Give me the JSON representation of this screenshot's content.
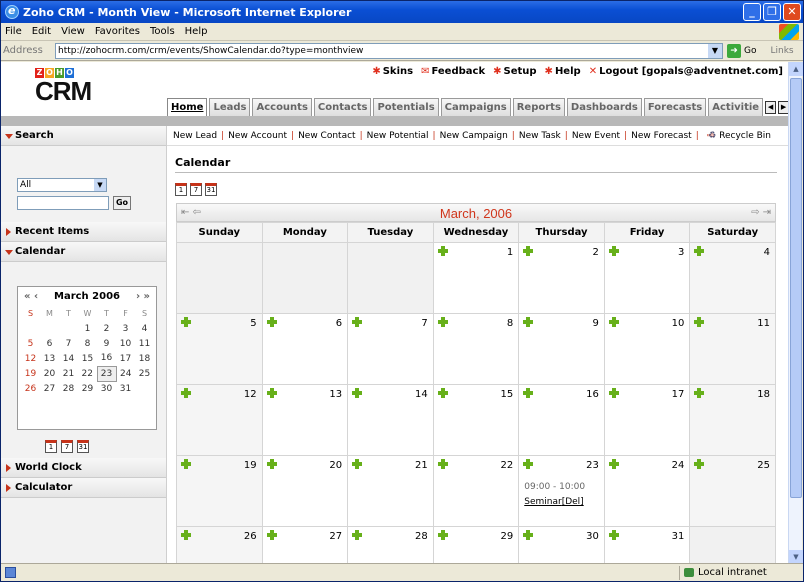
{
  "window": {
    "title": "Zoho CRM - Month View - Microsoft Internet Explorer"
  },
  "menu": [
    "File",
    "Edit",
    "View",
    "Favorites",
    "Tools",
    "Help"
  ],
  "address": {
    "label": "Address",
    "url": "http://zohocrm.com/crm/events/ShowCalendar.do?type=monthview",
    "go": "Go",
    "links": "Links"
  },
  "logo": {
    "zoho": [
      "Z",
      "O",
      "H",
      "O"
    ],
    "crm": "CRM"
  },
  "toplinks": [
    {
      "icon": "✱",
      "label": "Skins"
    },
    {
      "icon": "✉",
      "label": "Feedback"
    },
    {
      "icon": "✱",
      "label": "Setup"
    },
    {
      "icon": "✱",
      "label": "Help"
    },
    {
      "icon": "✕",
      "label": "Logout [gopals@adventnet.com]"
    }
  ],
  "tabs": [
    "Home",
    "Leads",
    "Accounts",
    "Contacts",
    "Potentials",
    "Campaigns",
    "Reports",
    "Dashboards",
    "Forecasts",
    "Activitie"
  ],
  "quick": [
    "New Lead",
    "New Account",
    "New Contact",
    "New Potential",
    "New Campaign",
    "New Task",
    "New Event",
    "New Forecast"
  ],
  "recycle": "Recycle Bin",
  "sidebar": {
    "search": "Search",
    "search_select": "All",
    "go": "Go",
    "recent": "Recent Items",
    "calendar": "Calendar",
    "world": "World Clock",
    "calc": "Calculator"
  },
  "mini": {
    "prev": "« ‹",
    "title": "March 2006",
    "next": "› »",
    "days": [
      "S",
      "M",
      "T",
      "W",
      "T",
      "F",
      "S"
    ],
    "weeks": [
      [
        "",
        "",
        "",
        "1",
        "2",
        "3",
        "4"
      ],
      [
        "5",
        "6",
        "7",
        "8",
        "9",
        "10",
        "11"
      ],
      [
        "12",
        "13",
        "14",
        "15",
        "16",
        "17",
        "18"
      ],
      [
        "19",
        "20",
        "21",
        "22",
        "23",
        "24",
        "25"
      ],
      [
        "26",
        "27",
        "28",
        "29",
        "30",
        "31",
        ""
      ]
    ],
    "icons": [
      "1",
      "7",
      "31"
    ]
  },
  "calendar": {
    "title": "Calendar",
    "month": "March, 2006",
    "days": [
      "Sunday",
      "Monday",
      "Tuesday",
      "Wednesday",
      "Thursday",
      "Friday",
      "Saturday"
    ],
    "weeks": [
      [
        "",
        "",
        "",
        "1",
        "2",
        "3",
        "4"
      ],
      [
        "5",
        "6",
        "7",
        "8",
        "9",
        "10",
        "11"
      ],
      [
        "12",
        "13",
        "14",
        "15",
        "16",
        "17",
        "18"
      ],
      [
        "19",
        "20",
        "21",
        "22",
        "23",
        "24",
        "25"
      ],
      [
        "26",
        "27",
        "28",
        "29",
        "30",
        "31",
        ""
      ]
    ],
    "event": {
      "day": "23",
      "time": "09:00 - 10:00",
      "name": "Seminar",
      "del": "[Del]"
    }
  },
  "status": {
    "zone": "Local intranet"
  }
}
